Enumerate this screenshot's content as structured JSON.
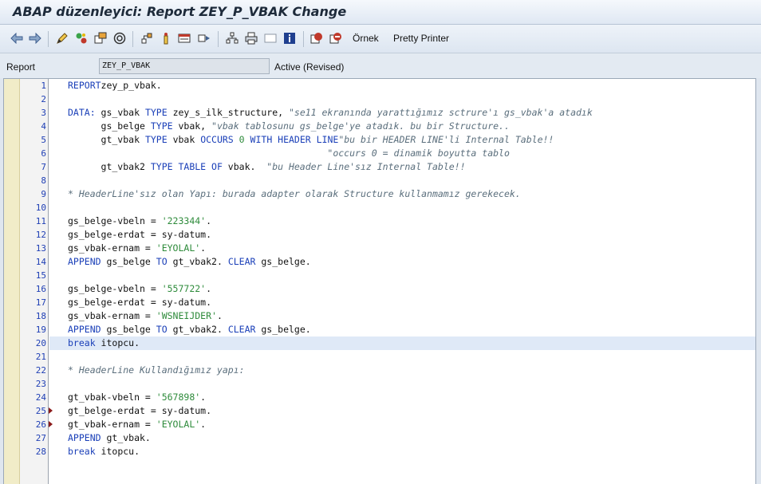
{
  "window": {
    "title": "ABAP düzenleyici: Report ZEY_P_VBAK Change"
  },
  "toolbar": {
    "buttons": [
      {
        "name": "back-arrow-icon"
      },
      {
        "name": "forward-arrow-icon"
      },
      {
        "name": "display-change-icon"
      },
      {
        "name": "active-inactive-icon"
      },
      {
        "name": "other-object-icon"
      },
      {
        "name": "check-icon"
      },
      {
        "name": "hierarchy-icon"
      },
      {
        "name": "where-used-icon"
      },
      {
        "name": "object-list-icon"
      },
      {
        "name": "navigation-window-icon"
      },
      {
        "name": "layout-icon"
      },
      {
        "name": "printer-icon"
      },
      {
        "name": "page-icon"
      },
      {
        "name": "info-icon"
      },
      {
        "name": "breakpoint-icon"
      },
      {
        "name": "session-breakpoint-icon"
      }
    ],
    "ornek_label": "Örnek",
    "pretty_printer_label": "Pretty Printer"
  },
  "header": {
    "report_label": "Report",
    "report_value": "ZEY_P_VBAK",
    "status": "Active (Revised)"
  },
  "editor": {
    "current_line": 20,
    "breakpoint_lines": [
      25,
      26
    ],
    "lines": [
      {
        "n": "1",
        "tokens": [
          [
            "kw",
            "REPORT"
          ],
          [
            "",
            "zey_p_vbak."
          ]
        ]
      },
      {
        "n": "2",
        "tokens": []
      },
      {
        "n": "3",
        "tokens": [
          [
            "kw",
            "DATA:"
          ],
          [
            "",
            " gs_vbak "
          ],
          [
            "kw",
            "TYPE"
          ],
          [
            "",
            " zey_s_ilk_structure, "
          ],
          [
            "cm",
            "\"se11 ekranında yarattığımız sctrure'ı gs_vbak'a atadık"
          ]
        ]
      },
      {
        "n": "4",
        "tokens": [
          [
            "",
            "      gs_belge "
          ],
          [
            "kw",
            "TYPE"
          ],
          [
            "",
            " vbak, "
          ],
          [
            "cm",
            "\"vbak tablosunu gs_belge'ye atadık. bu bir Structure.."
          ]
        ]
      },
      {
        "n": "5",
        "tokens": [
          [
            "",
            "      gt_vbak "
          ],
          [
            "kw",
            "TYPE"
          ],
          [
            "",
            " vbak "
          ],
          [
            "kw",
            "OCCURS"
          ],
          [
            "",
            " "
          ],
          [
            "num",
            "0"
          ],
          [
            "",
            " "
          ],
          [
            "kw",
            "WITH HEADER LINE"
          ],
          [
            ", "
          ],
          [
            "cm",
            "\"bu bir HEADER LINE'li Internal Table!!"
          ]
        ]
      },
      {
        "n": "6",
        "tokens": [
          [
            "cm",
            "                                               \"occurs 0 = dinamik boyutta tablo"
          ]
        ]
      },
      {
        "n": "7",
        "tokens": [
          [
            "",
            "      gt_vbak2 "
          ],
          [
            "kw",
            "TYPE TABLE OF"
          ],
          [
            "",
            " vbak.  "
          ],
          [
            "cm",
            "\"bu Header Line'sız Internal Table!!"
          ]
        ]
      },
      {
        "n": "8",
        "tokens": []
      },
      {
        "n": "9",
        "tokens": [
          [
            "cm",
            "* HeaderLine'sız olan Yapı: burada adapter olarak Structure kullanmamız gerekecek."
          ]
        ]
      },
      {
        "n": "10",
        "tokens": []
      },
      {
        "n": "11",
        "tokens": [
          [
            "",
            "gs_belge-vbeln = "
          ],
          [
            "str",
            "'223344'"
          ],
          [
            "",
            "."
          ]
        ]
      },
      {
        "n": "12",
        "tokens": [
          [
            "",
            "gs_belge-erdat = sy-datum."
          ]
        ]
      },
      {
        "n": "13",
        "tokens": [
          [
            "",
            "gs_vbak-ernam = "
          ],
          [
            "str",
            "'EYOLAL'"
          ],
          [
            "",
            "."
          ]
        ]
      },
      {
        "n": "14",
        "tokens": [
          [
            "kw",
            "APPEND"
          ],
          [
            "",
            " gs_belge "
          ],
          [
            "kw",
            "TO"
          ],
          [
            "",
            " gt_vbak2. "
          ],
          [
            "kw",
            "CLEAR"
          ],
          [
            "",
            " gs_belge."
          ]
        ]
      },
      {
        "n": "15",
        "tokens": []
      },
      {
        "n": "16",
        "tokens": [
          [
            "",
            "gs_belge-vbeln = "
          ],
          [
            "str",
            "'557722'"
          ],
          [
            "",
            "."
          ]
        ]
      },
      {
        "n": "17",
        "tokens": [
          [
            "",
            "gs_belge-erdat = sy-datum."
          ]
        ]
      },
      {
        "n": "18",
        "tokens": [
          [
            "",
            "gs_vbak-ernam = "
          ],
          [
            "str",
            "'WSNEIJDER'"
          ],
          [
            "",
            "."
          ]
        ]
      },
      {
        "n": "19",
        "tokens": [
          [
            "kw",
            "APPEND"
          ],
          [
            "",
            " gs_belge "
          ],
          [
            "kw",
            "TO"
          ],
          [
            "",
            " gt_vbak2. "
          ],
          [
            "kw",
            "CLEAR"
          ],
          [
            "",
            " gs_belge."
          ]
        ]
      },
      {
        "n": "20",
        "tokens": [
          [
            "kw",
            "break"
          ],
          [
            "",
            " itopcu."
          ]
        ]
      },
      {
        "n": "21",
        "tokens": []
      },
      {
        "n": "22",
        "tokens": [
          [
            "cm",
            "* HeaderLine Kullandığımız yapı:"
          ]
        ]
      },
      {
        "n": "23",
        "tokens": []
      },
      {
        "n": "24",
        "tokens": [
          [
            "",
            "gt_vbak-vbeln = "
          ],
          [
            "str",
            "'567898'"
          ],
          [
            "",
            "."
          ]
        ]
      },
      {
        "n": "25",
        "tokens": [
          [
            "",
            "gt_belge-erdat = sy-datum."
          ]
        ]
      },
      {
        "n": "26",
        "tokens": [
          [
            "",
            "gt_vbak-ernam = "
          ],
          [
            "str",
            "'EYOLAL'"
          ],
          [
            "",
            "."
          ]
        ]
      },
      {
        "n": "27",
        "tokens": [
          [
            "kw",
            "APPEND"
          ],
          [
            "",
            " gt_vbak."
          ]
        ]
      },
      {
        "n": "28",
        "tokens": [
          [
            "kw",
            "break"
          ],
          [
            "",
            " itopcu."
          ]
        ]
      }
    ]
  }
}
